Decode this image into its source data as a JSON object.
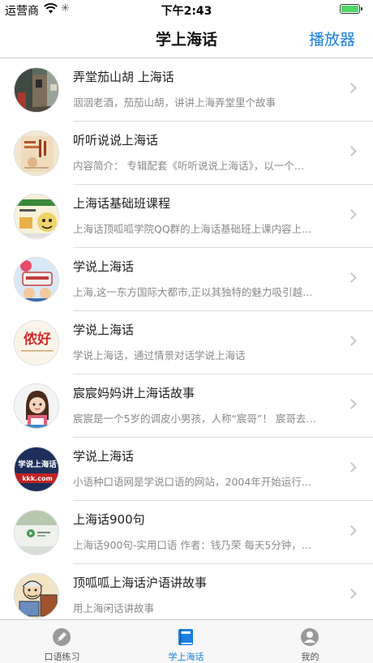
{
  "status_bar": {
    "carrier": "运营商",
    "time": "下午2:43",
    "battery_level": 1.0
  },
  "nav": {
    "title": "学上海话",
    "right_button": "播放器"
  },
  "list": [
    {
      "title": "弄堂茄山胡 上海话",
      "subtitle": "洇洇老酒，茄茄山胡，讲讲上海弄堂里个故事",
      "thumb": "photo-alley"
    },
    {
      "title": "听听说说上海话",
      "subtitle": "内容简介： 专辑配套《听听说说上海话》，以一个…",
      "thumb": "book-cover"
    },
    {
      "title": "上海话基础班课程",
      "subtitle": "上海话顶呱呱学院QQ群的上海话基础班上课内容上…",
      "thumb": "cartoon"
    },
    {
      "title": "学说上海话",
      "subtitle": "上海,这一东方国际大都市,正以其独特的魅力吸引越…",
      "thumb": "book-cover-2"
    },
    {
      "title": "学说上海话",
      "subtitle": "学说上海话，通过情景对话学说上海话",
      "thumb": "nonghao-text"
    },
    {
      "title": "宸宸妈妈讲上海话故事",
      "subtitle": "宸宸是一个5岁的调皮小男孩，人称“宸哥”！ 宸哥去…",
      "thumb": "girl-avatar"
    },
    {
      "title": "学说上海话",
      "subtitle": "小语种口语网是学说口语的网站，2004年开始运行…",
      "thumb": "dark-banner"
    },
    {
      "title": "上海话900句",
      "subtitle": "上海话900句-实用口语 作者：钱乃荣 每天5分钟，…",
      "thumb": "green-play"
    },
    {
      "title": "顶呱呱上海话沪语讲故事",
      "subtitle": "用上海闲话讲故事",
      "thumb": "comic"
    }
  ],
  "thumb_texts": {
    "banner": "学说上海话",
    "banner_url": "kkk.com",
    "nonghao": "侬好"
  },
  "tabs": [
    {
      "label": "口语练习",
      "icon": "pencil-icon",
      "active": false
    },
    {
      "label": "学上海话",
      "icon": "book-icon",
      "active": true
    },
    {
      "label": "我的",
      "icon": "person-icon",
      "active": false
    }
  ],
  "colors": {
    "accent": "#1a7fe0",
    "battery": "#4cd964",
    "subtitle": "#8a8a8a"
  }
}
